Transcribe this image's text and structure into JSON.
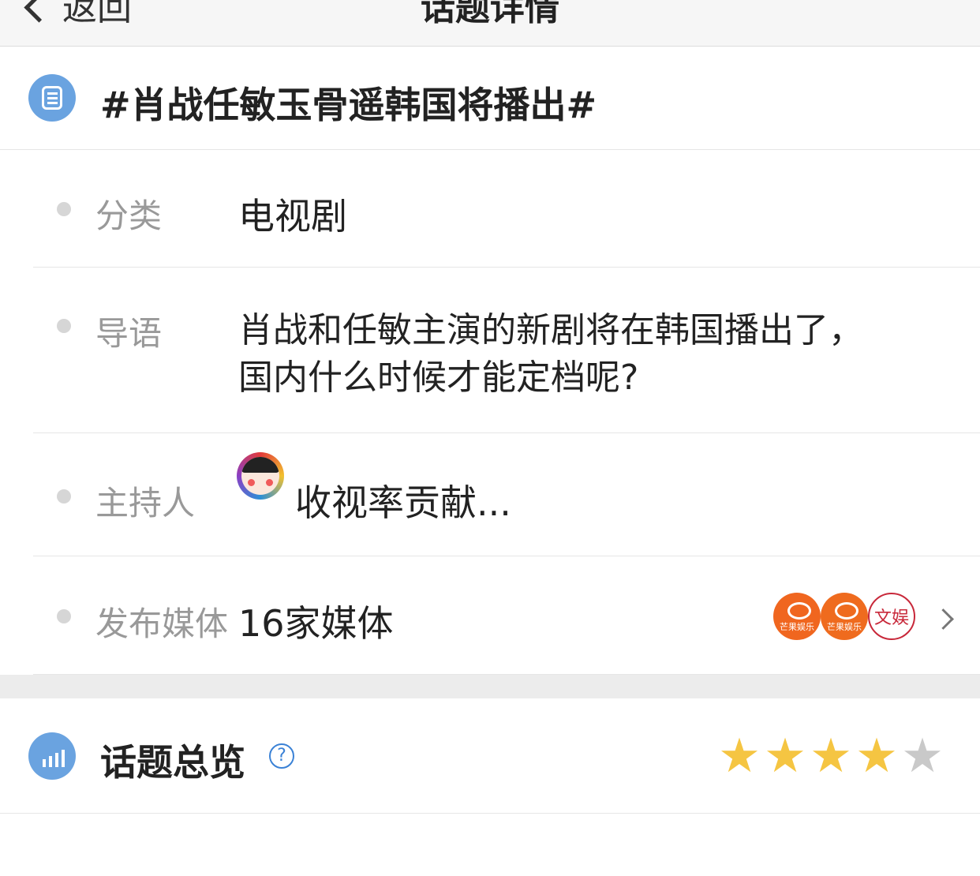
{
  "nav": {
    "back_label": "返回",
    "title": "话题详情"
  },
  "topic": {
    "title": "#肖战任敏玉骨遥韩国将播出#",
    "icon": "document-list-icon"
  },
  "details": {
    "category": {
      "label": "分类",
      "value": "电视剧"
    },
    "intro": {
      "label": "导语",
      "line1": "肖战和任敏主演的新剧将在韩国播出了，",
      "line2": "国内什么时候才能定档呢?"
    },
    "host": {
      "label": "主持人",
      "name": "收视率贡献..."
    },
    "media": {
      "label": "发布媒体",
      "value": "16家媒体",
      "logos": [
        {
          "text": "芒果娱乐"
        },
        {
          "text": "芒果娱乐"
        },
        {
          "text": "文娱"
        }
      ]
    }
  },
  "overview": {
    "title": "话题总览",
    "help_icon": "question-circle-icon",
    "rating": 4,
    "rating_max": 5,
    "star_on_color": "#f5c542",
    "star_off_color": "#c9c9c9"
  },
  "colors": {
    "accent": "#6aa3e0",
    "link": "#3b82d6",
    "media_orange": "#f0661f",
    "media_red": "#c8283a"
  }
}
